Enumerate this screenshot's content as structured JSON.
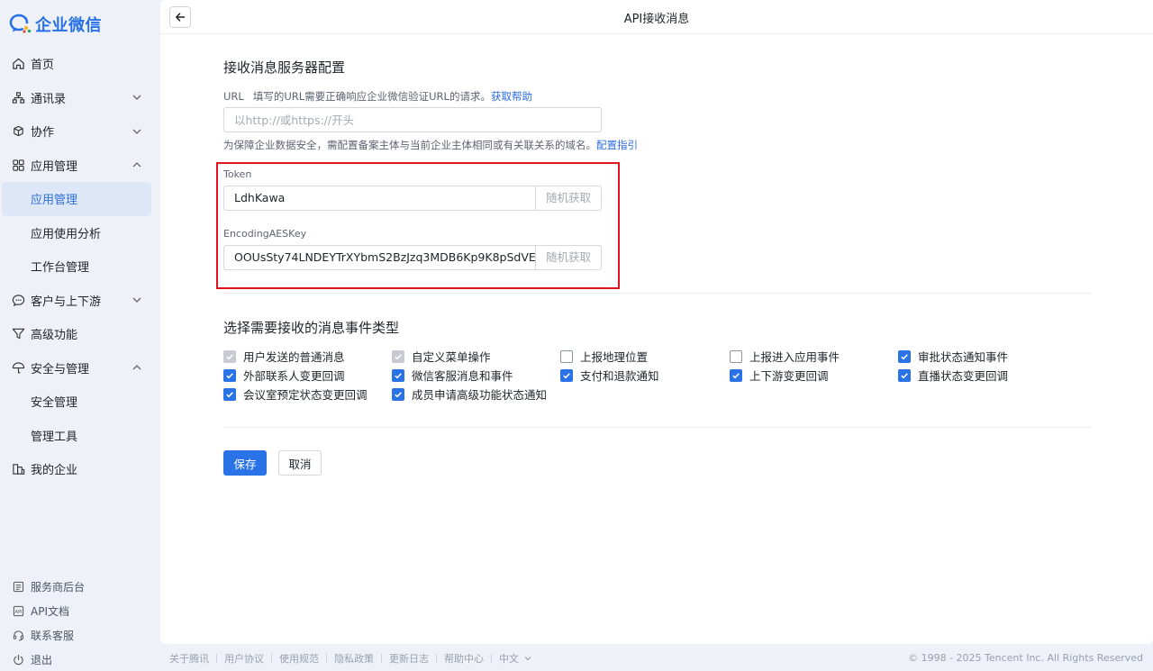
{
  "app": {
    "name": "企业微信",
    "accent": "#2a73e6"
  },
  "sidebar": {
    "items": [
      {
        "label": "首页",
        "icon": "home-icon"
      },
      {
        "label": "通讯录",
        "icon": "org-chart-icon",
        "expandable": true,
        "expanded": false
      },
      {
        "label": "协作",
        "icon": "collaboration-icon",
        "expandable": true,
        "expanded": false
      },
      {
        "label": "应用管理",
        "icon": "apps-grid-icon",
        "expandable": true,
        "expanded": true
      },
      {
        "label": "应用管理",
        "sub": true,
        "active": true
      },
      {
        "label": "应用使用分析",
        "sub": true
      },
      {
        "label": "工作台管理",
        "sub": true
      },
      {
        "label": "客户与上下游",
        "icon": "chat-bubble-icon",
        "expandable": true,
        "expanded": false
      },
      {
        "label": "高级功能",
        "icon": "filter-icon"
      },
      {
        "label": "安全与管理",
        "icon": "umbrella-icon",
        "expandable": true,
        "expanded": true
      },
      {
        "label": "安全管理",
        "sub": true
      },
      {
        "label": "管理工具",
        "sub": true
      },
      {
        "label": "我的企业",
        "icon": "building-icon"
      }
    ],
    "bottom": [
      {
        "label": "服务商后台",
        "icon": "list-doc-icon"
      },
      {
        "label": "API文档",
        "icon": "api-icon"
      },
      {
        "label": "联系客服",
        "icon": "headset-icon"
      },
      {
        "label": "退出",
        "icon": "power-icon"
      }
    ]
  },
  "header": {
    "title": "API接收消息"
  },
  "server_config": {
    "title": "接收消息服务器配置",
    "url_label": "URL",
    "url_hint": "填写的URL需要正确响应企业微信验证URL的请求。",
    "url_help_link": "获取帮助",
    "url_value": "",
    "url_placeholder": "以http://或https://开头",
    "domain_note": "为保障企业数据安全，需配置备案主体与当前企业主体相同或有关联关系的域名。",
    "domain_note_link": "配置指引",
    "token_label": "Token",
    "token_value": "LdhKawa",
    "token_random": "随机获取",
    "aes_label": "EncodingAESKey",
    "aes_value": "OOUsSty74LNDEYTrXYbmS2BzJzq3MDB6Kp9K8pSdVE",
    "aes_random": "随机获取"
  },
  "events": {
    "title": "选择需要接收的消息事件类型",
    "items": [
      {
        "label": "用户发送的普通消息",
        "state": "disabled"
      },
      {
        "label": "自定义菜单操作",
        "state": "disabled"
      },
      {
        "label": "上报地理位置",
        "state": "unchecked"
      },
      {
        "label": "上报进入应用事件",
        "state": "unchecked"
      },
      {
        "label": "审批状态通知事件",
        "state": "checked"
      },
      {
        "label": "外部联系人变更回调",
        "state": "checked"
      },
      {
        "label": "微信客服消息和事件",
        "state": "checked"
      },
      {
        "label": "支付和退款通知",
        "state": "checked"
      },
      {
        "label": "上下游变更回调",
        "state": "checked"
      },
      {
        "label": "直播状态变更回调",
        "state": "checked"
      },
      {
        "label": "会议室预定状态变更回调",
        "state": "checked"
      },
      {
        "label": "成员申请高级功能状态通知",
        "state": "checked"
      }
    ]
  },
  "actions": {
    "save": "保存",
    "cancel": "取消"
  },
  "footer": {
    "links": [
      "关于腾讯",
      "用户协议",
      "使用规范",
      "隐私政策",
      "更新日志",
      "帮助中心"
    ],
    "language": "中文",
    "copyright": "© 1998 - 2025 Tencent Inc. All Rights Reserved"
  }
}
